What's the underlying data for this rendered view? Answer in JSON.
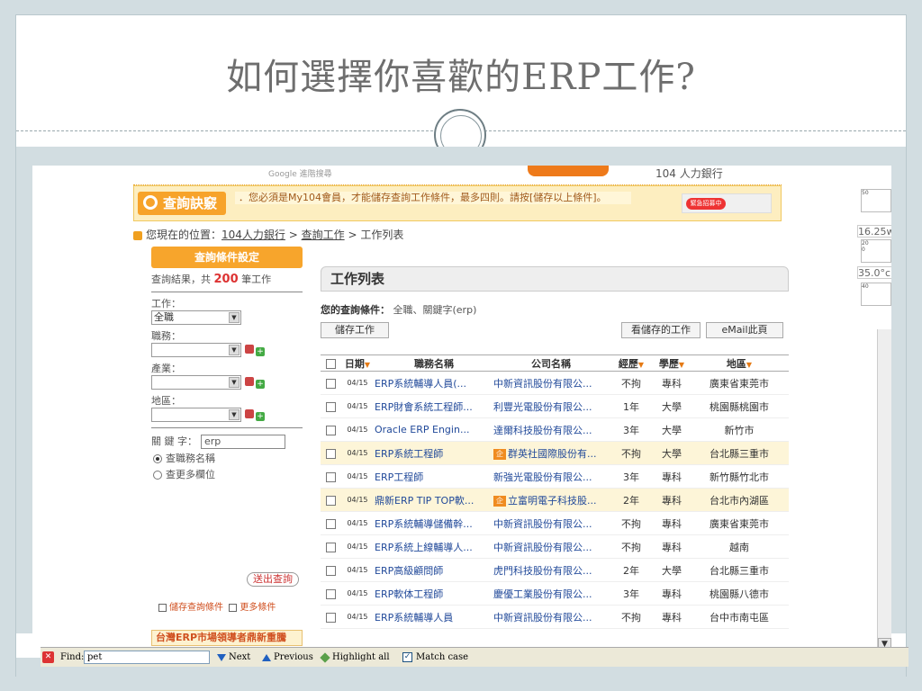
{
  "slide": {
    "title": "如何選擇你喜歡的ERP工作?"
  },
  "banner": {
    "google_text": "Google 進階搜尋",
    "ad_text": "104 人力銀行"
  },
  "tip": {
    "logo": "查詢訣竅",
    "text": "．您必須是My104會員，才能儲存查詢工作條件，最多四則。請按[儲存以上條件]。",
    "badge": "緊急招募中"
  },
  "breadcrumb": {
    "prefix": "您現在的位置：",
    "home": "104人力銀行",
    "sep1": " > ",
    "search": "查詢工作",
    "sep2": " > ",
    "current": "工作列表"
  },
  "sidebar": {
    "header": "查詢條件設定",
    "result_prefix": "查詢結果，共",
    "result_count": "200",
    "result_suffix": "筆工作",
    "job_label": "工作：",
    "job_value": "全職",
    "duty_label": "職務：",
    "industry_label": "產業：",
    "area_label": "地區：",
    "keyword_label": "關 鍵 字：",
    "keyword_value": "erp",
    "radio1": "查職務名稱",
    "radio2": "查更多欄位",
    "submit": "送出查詢",
    "save_link": "儲存查詢條件",
    "more_link": "更多條件",
    "bottom_text": "台灣ERP市場領導者鼎新重騰"
  },
  "main": {
    "header": "工作列表",
    "cond_label": "您的查詢條件：",
    "cond_value": "全職、關鍵字(erp)",
    "btn_save": "儲存工作",
    "btn_view_saved": "看儲存的工作",
    "btn_email": "eMail此頁",
    "columns": {
      "date": "日期",
      "title": "職務名稱",
      "company": "公司名稱",
      "exp": "經歷",
      "edu": "學歷",
      "area": "地區"
    },
    "rows": [
      {
        "date": "04/15",
        "title": "ERP系統輔導人員(...",
        "company": "中新資訊股份有限公...",
        "exp": "不拘",
        "edu": "專科",
        "area": "廣東省東莞市",
        "chip": ""
      },
      {
        "date": "04/15",
        "title": "ERP財會系統工程師...",
        "company": "利豐光電股份有限公...",
        "exp": "1年",
        "edu": "大學",
        "area": "桃園縣桃園市",
        "chip": ""
      },
      {
        "date": "04/15",
        "title": "Oracle ERP Engin...",
        "company": "達爾科技股份有限公...",
        "exp": "3年",
        "edu": "大學",
        "area": "新竹市",
        "chip": ""
      },
      {
        "date": "04/15",
        "title": "ERP系統工程師",
        "company": "群英社國際股份有...",
        "exp": "不拘",
        "edu": "大學",
        "area": "台北縣三重市",
        "chip": "企"
      },
      {
        "date": "04/15",
        "title": "ERP工程師",
        "company": "新強光電股份有限公...",
        "exp": "3年",
        "edu": "專科",
        "area": "新竹縣竹北市",
        "chip": ""
      },
      {
        "date": "04/15",
        "title": "鼎新ERP TIP TOP軟...",
        "company": "立富明電子科技股...",
        "exp": "2年",
        "edu": "專科",
        "area": "台北市內湖區",
        "chip": "企"
      },
      {
        "date": "04/15",
        "title": "ERP系統輔導儲備幹...",
        "company": "中新資訊股份有限公...",
        "exp": "不拘",
        "edu": "專科",
        "area": "廣東省東莞市",
        "chip": ""
      },
      {
        "date": "04/15",
        "title": "ERP系統上線輔導人...",
        "company": "中新資訊股份有限公...",
        "exp": "不拘",
        "edu": "專科",
        "area": "越南",
        "chip": ""
      },
      {
        "date": "04/15",
        "title": "ERP高級顧問師",
        "company": "虎門科技股份有限公...",
        "exp": "2年",
        "edu": "大學",
        "area": "台北縣三重市",
        "chip": ""
      },
      {
        "date": "04/15",
        "title": "ERP軟体工程師",
        "company": "慶優工業股份有限公...",
        "exp": "3年",
        "edu": "專科",
        "area": "桃園縣八德市",
        "chip": ""
      },
      {
        "date": "04/15",
        "title": "ERP系統輔導人員",
        "company": "中新資訊股份有限公...",
        "exp": "不拘",
        "edu": "專科",
        "area": "台中市南屯區",
        "chip": ""
      }
    ]
  },
  "widget": {
    "tick1": "50",
    "value1": "16.25w",
    "tick2": "20",
    "tick3": "0",
    "value2": "35.0°c",
    "tick4": "40"
  },
  "findbar": {
    "label": "Find:",
    "value": "pet",
    "next": "Next",
    "previous": "Previous",
    "highlight": "Highlight all",
    "match_case": "Match case"
  }
}
